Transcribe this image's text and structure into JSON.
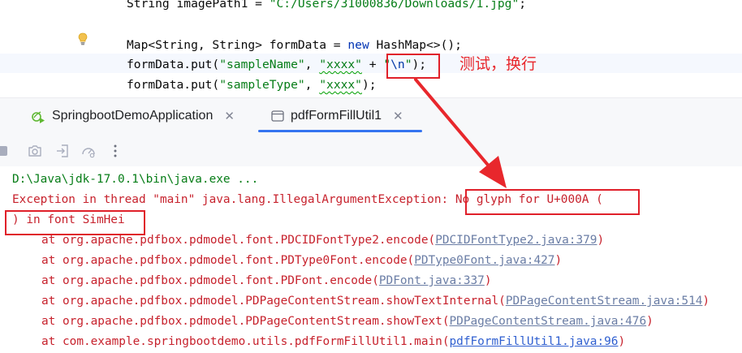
{
  "editor": {
    "lines": [
      {
        "pre": "String imagePath1 = ",
        "str": "\"C:/Users/31000836/Downloads/1.jpg\"",
        "post": ";"
      },
      {
        "pre": "Map<String, String> formData = ",
        "kw": "new",
        "post": " HashMap<>();"
      },
      {
        "pre": "formData.put(",
        "str1": "\"sampleName\"",
        "mid": ", ",
        "str2": "\"xxxx\"",
        "mid2": " + ",
        "esc_q1": "\"",
        "esc": "\\n",
        "esc_q2": "\"",
        "post": ");"
      },
      {
        "pre": "formData.put(",
        "str1": "\"sampleType\"",
        "mid": ", ",
        "str2": "\"xxxx\"",
        "post": ");"
      }
    ]
  },
  "tabs": [
    {
      "label": "SpringbootDemoApplication",
      "icon": "spring-run-icon",
      "active": false
    },
    {
      "label": "pdfFormFillUtil1",
      "icon": "console-icon",
      "active": true
    }
  ],
  "toolbar": {
    "icons": [
      "stop-icon",
      "camera-icon",
      "login-icon",
      "dashboard-icon",
      "more-icon"
    ]
  },
  "console": {
    "command": "D:\\Java\\jdk-17.0.1\\bin\\java.exe ...",
    "exception_prefix": "Exception in thread \"main\" java.lang.IllegalArgumentException: ",
    "exception_msg1": "No glyph for U+000A (",
    "exception_msg2": ") in font SimHei",
    "stack": [
      {
        "at": "at org.apache.pdfbox.pdmodel.font.PDCIDFontType2.encode(",
        "link": "PDCIDFontType2.java:379",
        "end": ")"
      },
      {
        "at": "at org.apache.pdfbox.pdmodel.font.PDType0Font.encode(",
        "link": "PDType0Font.java:427",
        "end": ")"
      },
      {
        "at": "at org.apache.pdfbox.pdmodel.font.PDFont.encode(",
        "link": "PDFont.java:337",
        "end": ")"
      },
      {
        "at": "at org.apache.pdfbox.pdmodel.PDPageContentStream.showTextInternal(",
        "link": "PDPageContentStream.java:514",
        "end": ")"
      },
      {
        "at": "at org.apache.pdfbox.pdmodel.PDPageContentStream.showText(",
        "link": "PDPageContentStream.java:476",
        "end": ")"
      },
      {
        "at": "at com.example.springbootdemo.utils.pdfFormFillUtil1.main(",
        "link": "pdfFormFillUtil1.java:96",
        "end": ")"
      }
    ]
  },
  "annotation": {
    "text": "测试，换行",
    "color": "#e8272c"
  },
  "colors": {
    "accent": "#3574f0",
    "error": "#c7222d",
    "string": "#067d17",
    "keyword": "#0033b3"
  }
}
